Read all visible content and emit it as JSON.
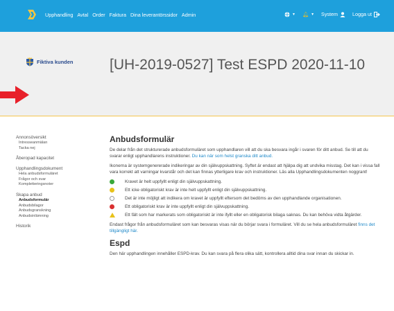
{
  "nav": {
    "items": [
      "Upphandling",
      "Avtal",
      "Order",
      "Faktura",
      "Dina leverantörssidor",
      "Admin"
    ]
  },
  "topright": {
    "system_label": "System",
    "logout_label": "Logga ut"
  },
  "brand": {
    "name": "Fiktiva kunden"
  },
  "page": {
    "title": "[UH-2019-0527] Test ESPD 2020-11-10"
  },
  "sidebar": {
    "annons": "Annonsöversikt",
    "annons_sub": [
      "Intresseanmälan",
      "Tacka nej"
    ],
    "aberopad": "Åberopad kapacitet",
    "dokument": "Upphandlingsdokument",
    "dokument_sub": [
      "Hela anbudsformuläret",
      "Frågor och svar",
      "Kompletteringsnoter"
    ],
    "skapa": "Skapa anbud",
    "skapa_active": "Anbudsformulär",
    "skapa_sub": [
      "Anbudsbilagor",
      "Anbudsgranskning",
      "Anbudsinlämning"
    ],
    "historik": "Historik"
  },
  "main": {
    "heading": "Anbudsformulär",
    "intro_text": "De delar från det strukturerade anbudsformuläret som upphandlaren vill att du ska besvara ingår i svaren för ditt anbud. Se till att du svarar enligt upphandlarens instruktioner.",
    "intro_link": "Du kan när som helst granska ditt anbud.",
    "icons_text": "Ikonerna är systemgenererade indikeringar av din självuppskattning. Syftet är endast att hjälpa dig att undvika misstag. Det kan i vissa fall vara korrekt att varningar kvarstår och det kan finnas ytterligare krav och instruktioner. Läs alla Upphandlingsdokumenten noggrant!",
    "legend": [
      "Kravet är helt uppfyllt enligt din självuppskattning.",
      "Ett icke obligatoriskt krav är inte helt uppfyllt enligt din självuppskattning.",
      "Det är inte möjligt att indikera om kravet är uppfyllt eftersom det bedöms av den upphandlande organisationen.",
      "Ett obligatoriskt krav är inte uppfyllt enligt din självuppskattning.",
      "Ett fält som har markerats som obligatoriskt är inte ifyllt eller en obligatorisk bilaga saknas. Du kan behöva vidta åtgärder."
    ],
    "note_text": "Endast frågor från anbudsformuläret som kan besvaras visas när du börjar svara i formuläret. Vill du se hela anbudsformuläret",
    "note_link": "finns det tillgängligt här.",
    "espd_heading": "Espd",
    "espd_text": "Den här upphandlingen innehåller ESPD-krav. Du kan svara på flera olika sätt, kontrollera alltid dina svar innan du skickar in."
  },
  "colors": {
    "topbar": "#1ea0dc",
    "header_bg": "#f0f0f0",
    "arrow": "#e8202a",
    "link": "#1e88c8"
  }
}
